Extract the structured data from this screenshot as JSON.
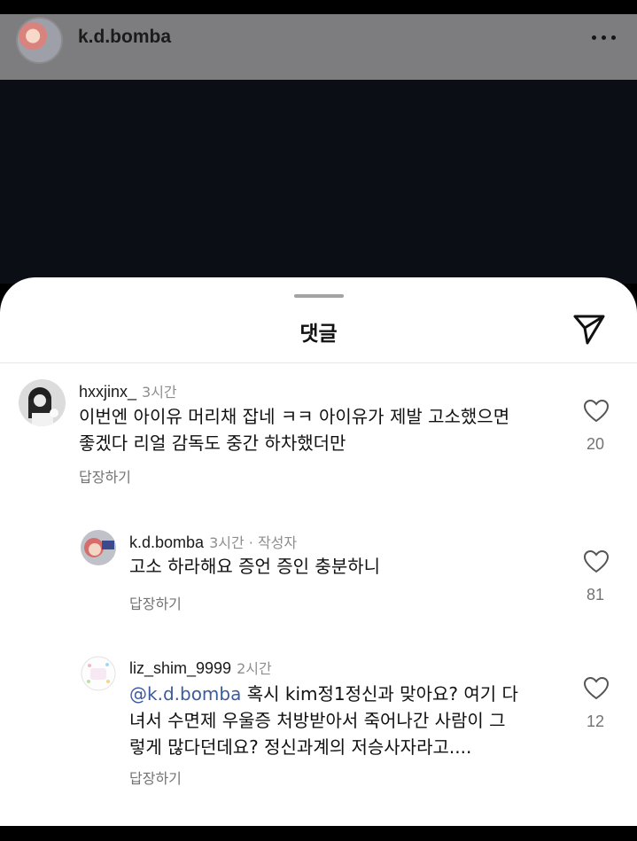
{
  "post": {
    "username": "k.d.bomba",
    "more_icon": "more-horizontal-icon"
  },
  "sheet": {
    "title": "댓글",
    "share_icon": "send-icon"
  },
  "comments": [
    {
      "username": "hxxjinx_",
      "time": "3시간",
      "text_lines": [
        "이번엔 아이유 머리채 잡네 ㅋㅋ 아이유가 제발 고소했으면",
        "좋겠다 리얼 감독도 중간 하차했더만"
      ],
      "reply_label": "답장하기",
      "likes": "20"
    },
    {
      "username": "k.d.bomba",
      "time": "3시간",
      "author_tag": "· 작성자",
      "text_lines": [
        "고소 하라해요 증언 증인 충분하니"
      ],
      "reply_label": "답장하기",
      "likes": "81"
    },
    {
      "username": "liz_shim_9999",
      "time": "2시간",
      "mention": "@k.d.bomba",
      "text_lines": [
        " 혹시 kim정1정신과 맞아요? 여기 다",
        "녀서 수면제 우울증 처방받아서 죽어나간 사람이 그",
        "렇게 많다던데요? 정신과계의 저승사자라고...."
      ],
      "reply_label": "답장하기",
      "likes": "12"
    }
  ]
}
